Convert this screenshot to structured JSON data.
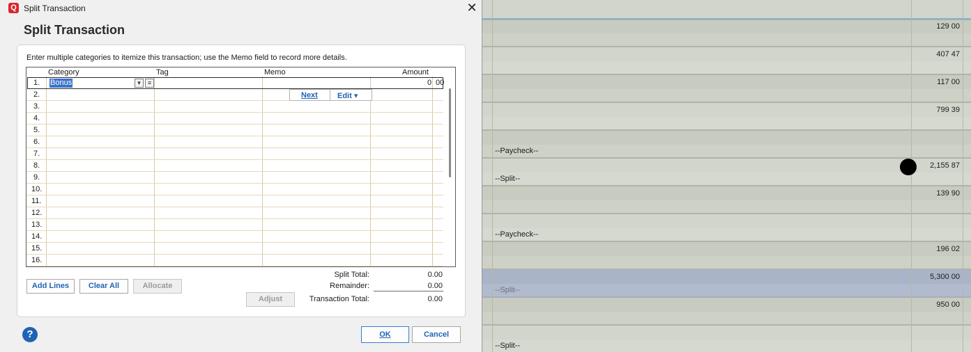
{
  "window": {
    "title": "Split Transaction",
    "close_glyph": "✕",
    "app_icon": "Q"
  },
  "dialog": {
    "heading": "Split Transaction",
    "instructions": "Enter multiple categories to itemize this transaction; use the Memo field to record more details.",
    "columns": {
      "category": "Category",
      "tag": "Tag",
      "memo": "Memo",
      "amount": "Amount"
    },
    "rows": [
      "1.",
      "2.",
      "3.",
      "4.",
      "5.",
      "6.",
      "7.",
      "8.",
      "9.",
      "10.",
      "11.",
      "12.",
      "13.",
      "14.",
      "15.",
      "16."
    ],
    "row1": {
      "category": "Bonus",
      "amount_whole": "0",
      "amount_cents": "00"
    },
    "inline_buttons": {
      "next": "Next",
      "edit": "Edit ▾"
    },
    "totals": {
      "split_total_label": "Split Total:",
      "split_total": "0.00",
      "remainder_label": "Remainder:",
      "remainder": "0.00",
      "transaction_total_label": "Transaction Total:",
      "transaction_total": "0.00"
    },
    "buttons": {
      "add_lines": "Add Lines",
      "clear_all": "Clear All",
      "allocate": "Allocate",
      "adjust": "Adjust",
      "ok": "OK",
      "cancel": "Cancel",
      "help": "?"
    }
  },
  "register": {
    "amounts": [
      "129 00",
      "407 47",
      "117 00",
      "799 39",
      "2,155 87",
      "139 90",
      "196 02",
      "5,300 00",
      "950 00"
    ],
    "payees": [
      "--Paycheck--",
      "--Split--",
      "--Paycheck--",
      "--Split--",
      "--Split--"
    ]
  }
}
